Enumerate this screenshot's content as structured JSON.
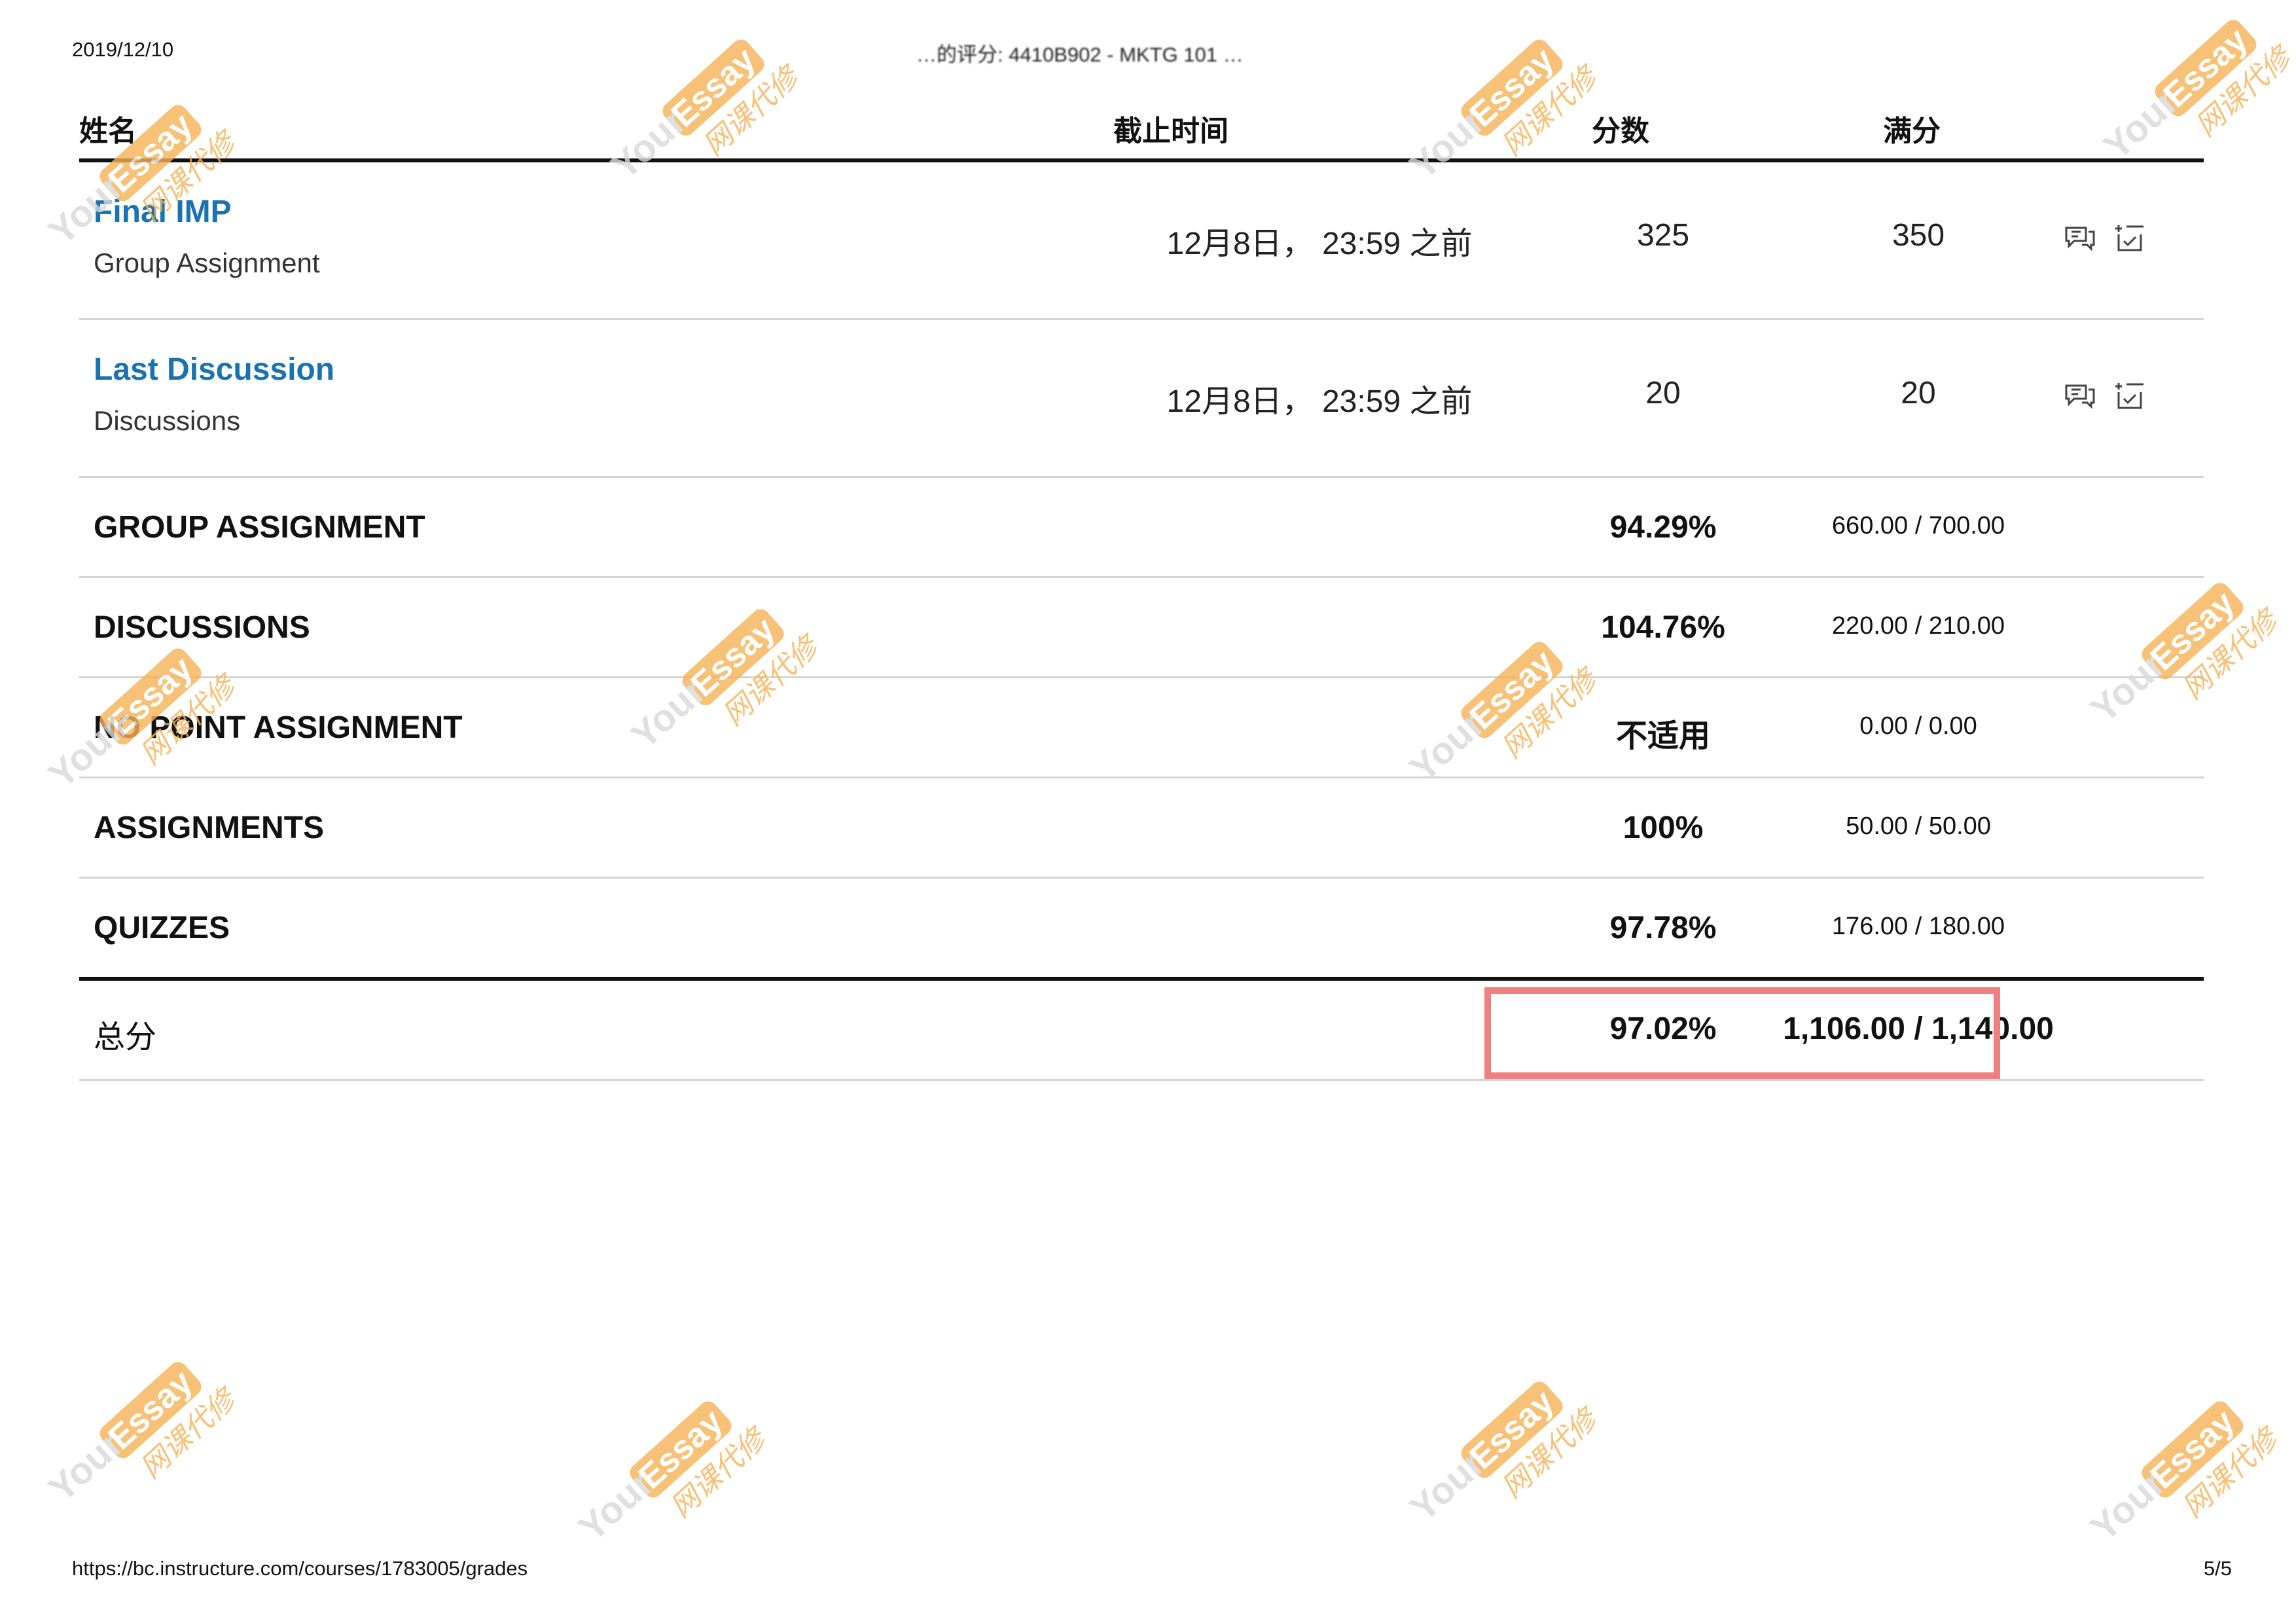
{
  "page_header": {
    "date": "2019/12/10",
    "title": "…的评分: 4410B902 - MKTG 101 …"
  },
  "table": {
    "headers": {
      "name": "姓名",
      "due": "截止时间",
      "score": "分数",
      "out_of": "满分"
    },
    "items": [
      {
        "name": "Final IMP",
        "group": "Group Assignment",
        "due": "12月8日， 23:59 之前",
        "score": "325",
        "out_of": "350"
      },
      {
        "name": "Last Discussion",
        "group": "Discussions",
        "due": "12月8日， 23:59 之前",
        "score": "20",
        "out_of": "20"
      }
    ],
    "groups": [
      {
        "name": "GROUP ASSIGNMENT",
        "percent": "94.29%",
        "points": "660.00 / 700.00"
      },
      {
        "name": "DISCUSSIONS",
        "percent": "104.76%",
        "points": "220.00 / 210.00"
      },
      {
        "name": "NO POINT ASSIGNMENT",
        "percent": "不适用",
        "points": "0.00 / 0.00"
      },
      {
        "name": "ASSIGNMENTS",
        "percent": "100%",
        "points": "50.00 / 50.00"
      },
      {
        "name": "QUIZZES",
        "percent": "97.78%",
        "points": "176.00 / 180.00"
      }
    ],
    "total": {
      "label": "总分",
      "percent": "97.02%",
      "points": "1,106.00 / 1,140.00"
    }
  },
  "page_footer": {
    "url": "https://bc.instructure.com/courses/1783005/grades",
    "page": "5/5"
  },
  "watermark": {
    "brand": "YourEssay",
    "tagline": "网课代修"
  },
  "icons": {
    "comment": "comment-icon",
    "rubric": "rubric-icon"
  },
  "colors": {
    "link": "#1a73b0",
    "highlight": "#f07f7f",
    "watermark": "#f7b257"
  }
}
